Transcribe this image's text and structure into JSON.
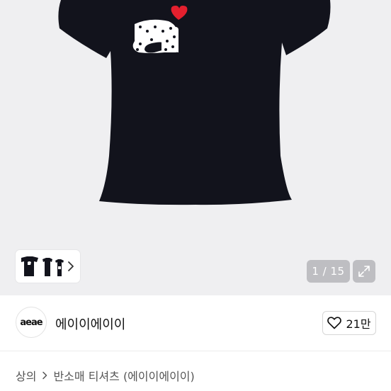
{
  "gallery": {
    "counter": "1 / 15",
    "icons": {
      "expand": "expand-icon",
      "chevron": "chevron-right-icon"
    }
  },
  "product_image": {
    "garment_color": "#12131c",
    "heart_color": "#e4202e"
  },
  "brand": {
    "logo_text": "aeae",
    "name": "에이이에이이",
    "likes": "21만",
    "icons": {
      "like": "heart-outline-icon"
    }
  },
  "breadcrumb": {
    "category": "상의",
    "subcategory": "반소매 티셔츠 (에이이에이이)"
  }
}
